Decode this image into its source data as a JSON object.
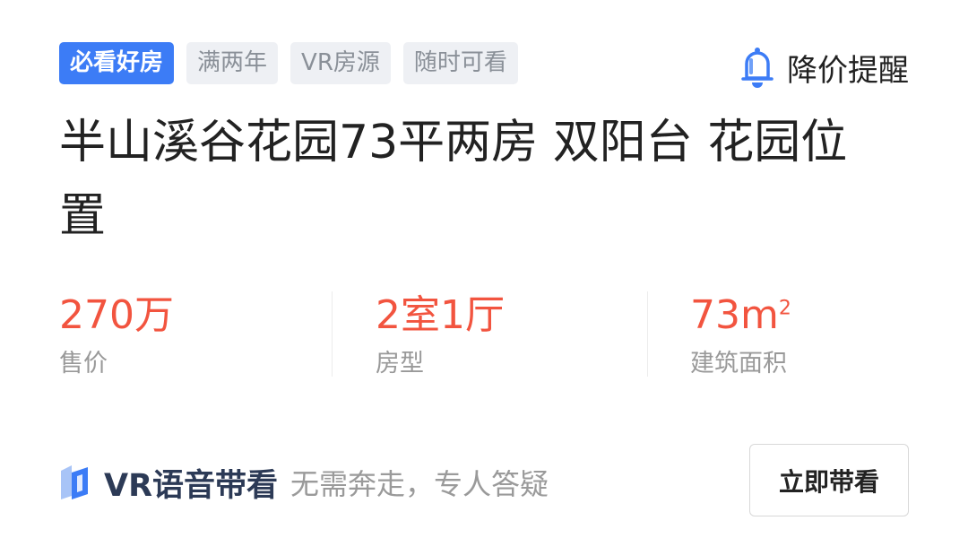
{
  "tags": [
    {
      "label": "必看好房",
      "style": "primary"
    },
    {
      "label": "满两年",
      "style": "secondary"
    },
    {
      "label": "VR房源",
      "style": "secondary"
    },
    {
      "label": "随时可看",
      "style": "secondary"
    }
  ],
  "price_alert": {
    "label": "降价提醒",
    "icon": "bell-icon"
  },
  "title": "半山溪谷花园73平两房 双阳台 花园位置",
  "stats": [
    {
      "value": "270万",
      "label": "售价"
    },
    {
      "value": "2室1厅",
      "label": "房型"
    },
    {
      "value": "73",
      "unit": "m",
      "sup": "2",
      "label": "建筑面积"
    }
  ],
  "vr": {
    "icon": "vr-logo-icon",
    "title": "VR语音带看",
    "subtitle": "无需奔走，专人答疑",
    "button_label": "立即带看"
  },
  "colors": {
    "accent": "#3c7cf6",
    "price": "#f2543f",
    "tag_bg": "#eef0f4",
    "tag_text": "#8a9098",
    "muted": "#999999",
    "vr_title": "#2c3a56"
  }
}
